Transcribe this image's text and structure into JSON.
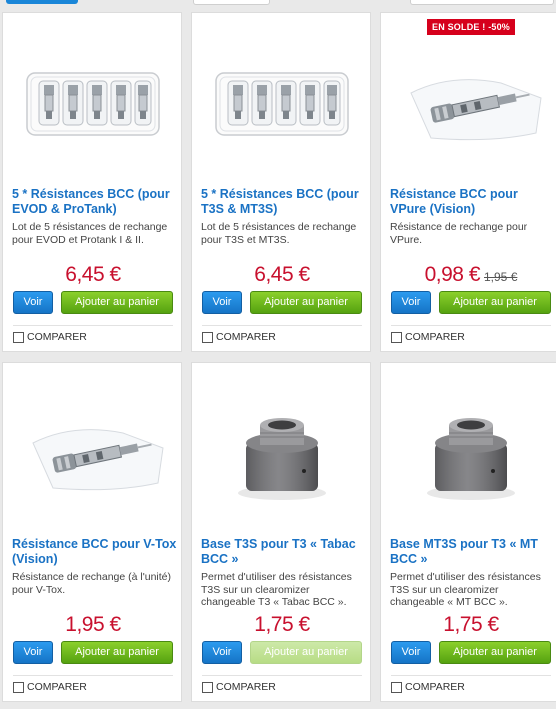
{
  "products": [
    {
      "name": "5 * Résistances BCC (pour EVOD & ProTank)",
      "description": "Lot de 5 résistances de rechange pour EVOD et Protank I & II.",
      "price": "6,45 €",
      "old_price": "",
      "badge": "",
      "image": "coil-pack-5",
      "view_label": "Voir",
      "cart_label": "Ajouter au panier",
      "cart_disabled": false,
      "compare_label": "COMPARER"
    },
    {
      "name": "5 * Résistances BCC (pour T3S & MT3S)",
      "description": "Lot de 5 résistances de rechange pour T3S et MT3S.",
      "price": "6,45 €",
      "old_price": "",
      "badge": "",
      "image": "coil-pack-5",
      "view_label": "Voir",
      "cart_label": "Ajouter au panier",
      "cart_disabled": false,
      "compare_label": "COMPARER"
    },
    {
      "name": "Résistance BCC pour VPure (Vision)",
      "description": "Résistance de rechange pour VPure.",
      "price": "0,98 €",
      "old_price": "1,95 €",
      "badge": "EN SOLDE ! -50%",
      "image": "single-coil",
      "view_label": "Voir",
      "cart_label": "Ajouter au panier",
      "cart_disabled": false,
      "compare_label": "COMPARER"
    },
    {
      "name": "Résistance BCC pour V-Tox (Vision)",
      "description": "Résistance de rechange (à l'unité) pour V-Tox.",
      "price": "1,95 €",
      "old_price": "",
      "badge": "",
      "image": "single-coil",
      "view_label": "Voir",
      "cart_label": "Ajouter au panier",
      "cart_disabled": false,
      "compare_label": "COMPARER"
    },
    {
      "name": "Base T3S pour T3 « Tabac BCC »",
      "description": "Permet d'utiliser des résistances T3S sur un clearomizer changeable T3 « Tabac BCC ».",
      "price": "1,75 €",
      "old_price": "",
      "badge": "",
      "image": "metal-base",
      "view_label": "Voir",
      "cart_label": "Ajouter au panier",
      "cart_disabled": true,
      "compare_label": "COMPARER"
    },
    {
      "name": "Base MT3S pour T3 « MT BCC »",
      "description": "Permet d'utiliser des résistances T3S sur un clearomizer changeable « MT BCC ».",
      "price": "1,75 €",
      "old_price": "",
      "badge": "",
      "image": "metal-base",
      "view_label": "Voir",
      "cart_label": "Ajouter au panier",
      "cart_disabled": false,
      "compare_label": "COMPARER"
    }
  ],
  "colors": {
    "title": "#1a72c4",
    "price": "#c8102e",
    "badge": "#d6001c",
    "view_button": "#1a86d8",
    "cart_button": "#6cb81b"
  }
}
